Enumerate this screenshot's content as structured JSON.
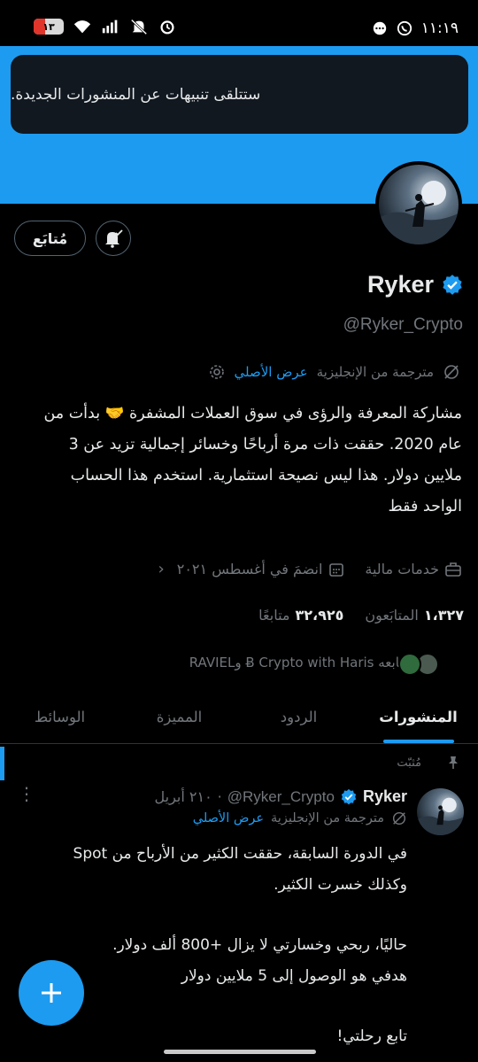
{
  "status_bar": {
    "time": "١١:١٩",
    "battery": "١٣",
    "icons": [
      "battery-icon",
      "wifi-icon",
      "signal-icon",
      "mute-icon",
      "alarm-icon",
      "whatsapp-icon",
      "chat-bubble-icon"
    ]
  },
  "toast": {
    "text": "ستتلقى تنبيهات عن المنشورات الجديدة."
  },
  "actions": {
    "follow_label": "مُتابَع"
  },
  "profile": {
    "name": "Ryker",
    "handle": "@Ryker_Crypto",
    "translated_label": "مترجمة من الإنجليزية",
    "show_original": "عرض الأصلي",
    "bio_lines": [
      "مشاركة المعرفة والرؤى في سوق العملات المشفرة 🤝 بدأت من",
      "عام 2020. حققت ذات مرة أرباحًا وخسائر إجمالية تزيد عن 3",
      "ملايين دولار. هذا ليس نصيحة استثمارية. استخدم هذا الحساب",
      "الواحد فقط"
    ],
    "category": "خدمات مالية",
    "joined": "انضمَ في أغسطس ٢٠٢١",
    "following_count": "١،٣٢٧",
    "following_label": "المتابَعون",
    "followers_count": "٣٢،٩٢٥",
    "followers_label": "متابعًا",
    "followed_by": "يُتابعه Ƀ Crypto with Haris وRAVIEL"
  },
  "tabs": [
    {
      "label": "المنشورات",
      "active": true
    },
    {
      "label": "الردود",
      "active": false
    },
    {
      "label": "المميزة",
      "active": false
    },
    {
      "label": "الوسائط",
      "active": false
    }
  ],
  "tweet": {
    "pinned_label": "مُثبّت",
    "name": "Ryker",
    "handle": "@Ryker_Crypto",
    "date": "٢١٠ أبريل",
    "separator": "·",
    "translated_label": "مترجمة من الإنجليزية",
    "show_original": "عرض الأصلي",
    "para1_line1": "في الدورة السابقة، حققت الكثير من الأرباح من Spot",
    "para1_line2": "وكذلك خسرت الكثير.",
    "para2_line1": "حاليًا، ربحي وخسارتي لا يزال +800 ألف دولار.",
    "para2_line2": "هدفي هو الوصول إلى 5 ملايين دولار",
    "para3_line1": "تابع رحلتي!"
  },
  "colors": {
    "accent": "#1d9bf0",
    "background": "#000000",
    "muted": "#71767b"
  }
}
